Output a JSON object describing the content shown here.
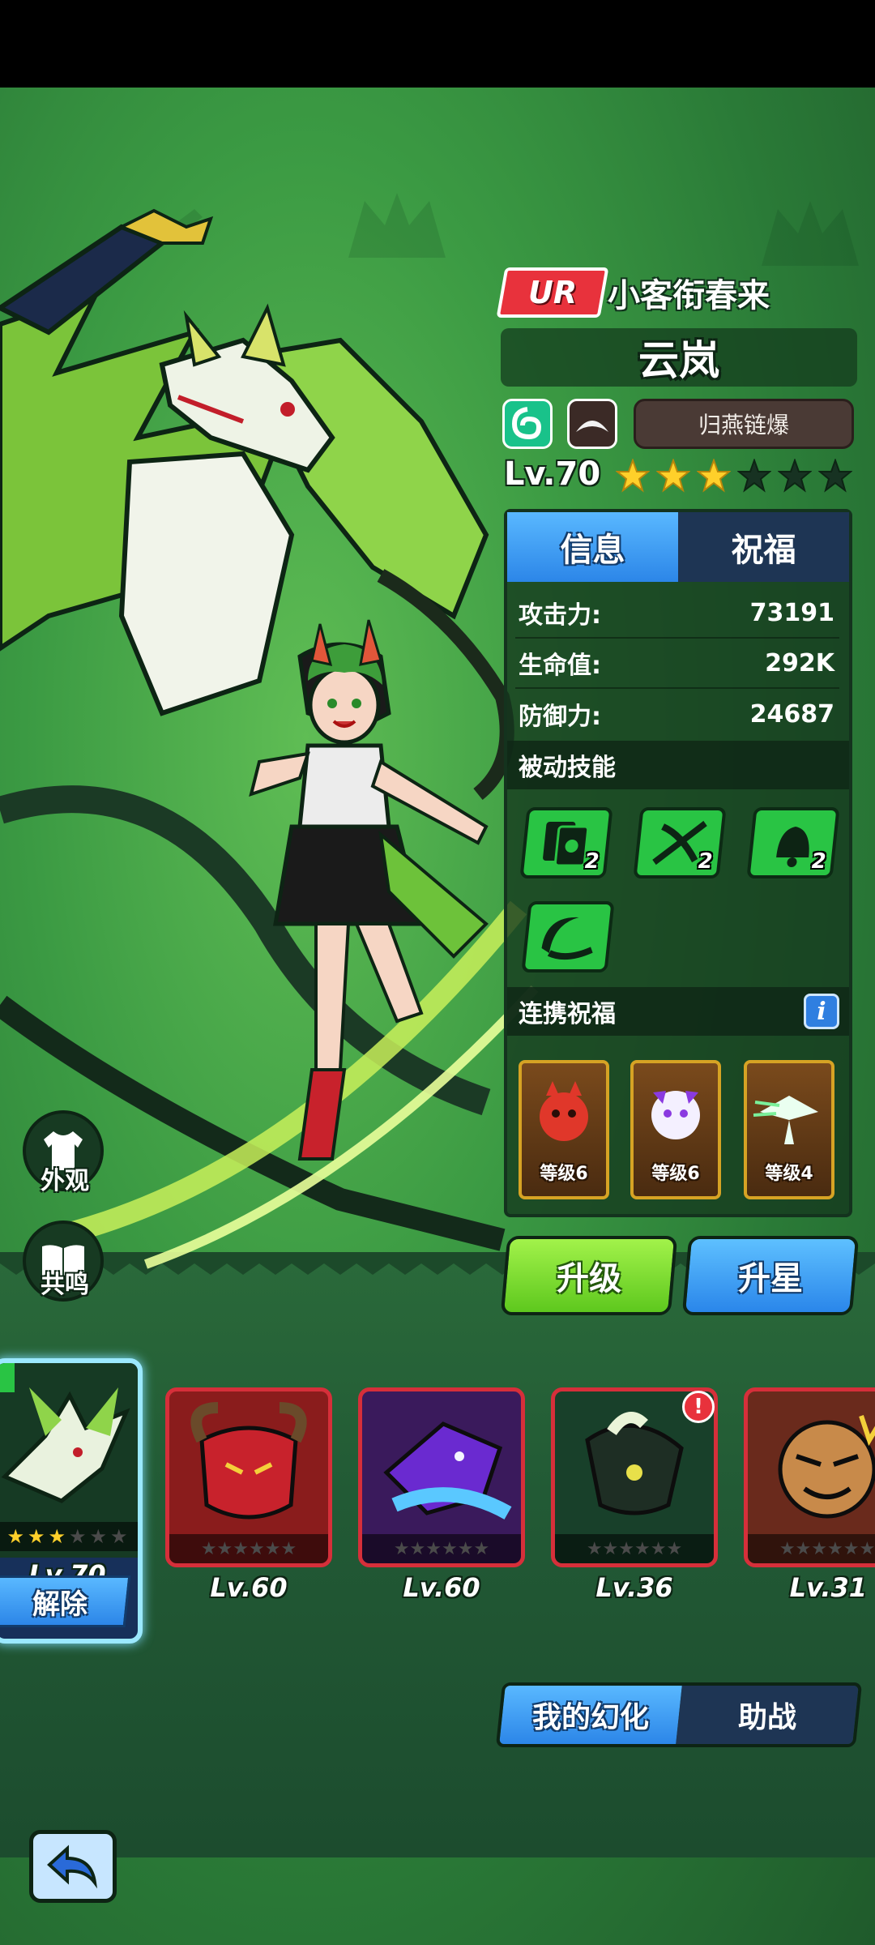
{
  "hero": {
    "rarity": "UR",
    "subtitle": "小客衔春来",
    "name": "云岚",
    "skill_name": "归燕链爆",
    "level_text": "Lv.70",
    "stars_filled": 3,
    "stars_total": 6
  },
  "tabs": {
    "info": "信息",
    "bless": "祝福"
  },
  "stats": [
    {
      "label": "攻击力:",
      "value": "73191"
    },
    {
      "label": "生命值:",
      "value": "292K"
    },
    {
      "label": "防御力:",
      "value": "24687"
    }
  ],
  "passive": {
    "title": "被动技能",
    "skills": [
      {
        "icon": "cards-icon",
        "level": "2"
      },
      {
        "icon": "crossbow-icon",
        "level": "2"
      },
      {
        "icon": "bell-icon",
        "level": "2"
      },
      {
        "icon": "boomerang-icon",
        "level": ""
      }
    ]
  },
  "link_bless": {
    "title": "连携祝福",
    "info_glyph": "i",
    "cards": [
      {
        "icon": "red-demon-icon",
        "caption": "等级6"
      },
      {
        "icon": "purple-demon-icon",
        "caption": "等级6"
      },
      {
        "icon": "white-dragon-icon",
        "caption": "等级4"
      }
    ]
  },
  "actions": {
    "upgrade": "升级",
    "star_up": "升星"
  },
  "side_buttons": {
    "appearance": "外观",
    "resonance": "共鸣"
  },
  "roster": {
    "selected": {
      "level": "Lv.70",
      "action": "解除",
      "stars_filled": 3
    },
    "items": [
      {
        "icon": "red-horned-demon-icon",
        "level": "Lv.60"
      },
      {
        "icon": "purple-dragon-icon",
        "level": "Lv.60"
      },
      {
        "icon": "green-spirit-icon",
        "level": "Lv.36",
        "alert": "!"
      },
      {
        "icon": "pumpkin-monster-icon",
        "level": "Lv.31"
      }
    ]
  },
  "bottom_tabs": {
    "mine": "我的幻化",
    "assist": "助战"
  },
  "colors": {
    "accent_blue": "#2c86e8",
    "accent_green": "#5ec81e",
    "rarity_red": "#e8323c",
    "bg_green": "#3b9a43"
  }
}
